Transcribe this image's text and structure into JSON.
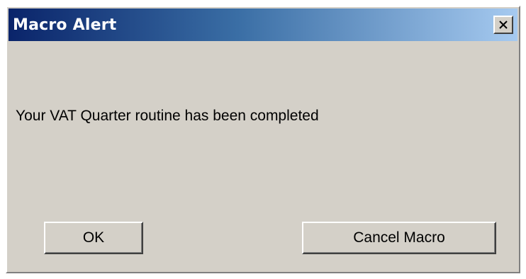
{
  "window": {
    "title": "Macro Alert",
    "close_icon": "close-icon"
  },
  "message": {
    "text": "Your VAT Quarter routine has been completed"
  },
  "buttons": {
    "ok_label": "OK",
    "cancel_label": "Cancel Macro"
  },
  "colors": {
    "title_gradient_start": "#0a246a",
    "title_gradient_end": "#a6caf0",
    "dialog_face": "#d4d0c8"
  }
}
